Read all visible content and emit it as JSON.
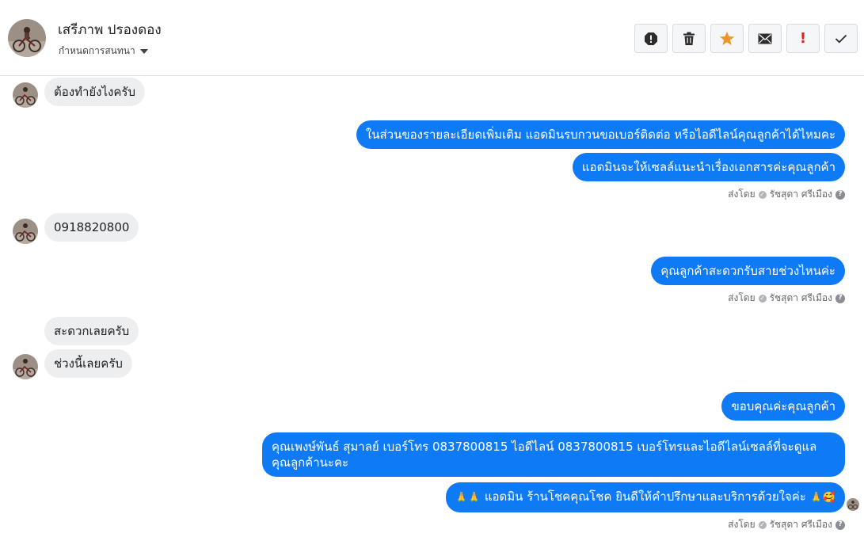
{
  "header": {
    "contact_name": "เสรีภาพ ปรองดอง",
    "assign_label": "กำหนดการสนทนา"
  },
  "toolbar": {
    "icons": [
      "info-icon",
      "trash-icon",
      "star-icon",
      "mail-icon",
      "important-icon",
      "check-icon"
    ],
    "star_color": "#f0952b",
    "important_color": "#e02020",
    "important_glyph": "!"
  },
  "messages": [
    {
      "dir": "in",
      "text": "ต้องทำยังไงครับ"
    },
    {
      "dir": "out",
      "text": "ในส่วนของรายละเอียดเพิ่มเติม แอดมินรบกวนขอเบอร์ติดต่อ หรือไอดีไลน์คุณลูกค้าได้ไหมคะ"
    },
    {
      "dir": "out",
      "text": "แอดมินจะให้เซลล์แนะนำเรื่องเอกสารค่ะคุณลูกค้า"
    },
    {
      "dir": "in",
      "text": "0918820800"
    },
    {
      "dir": "out",
      "text": "คุณลูกค้าสะดวกรับสายช่วงไหนค่ะ"
    },
    {
      "dir": "in",
      "text": "สะดวกเลยครับ"
    },
    {
      "dir": "in",
      "text": "ช่วงนี้เลยครับ"
    },
    {
      "dir": "out",
      "text": "ขอบคุณค่ะคุณลูกค้า"
    },
    {
      "dir": "out",
      "text": "คุณเพงษ์พันธ์ สุมาลย์      เบอร์โทร 0837800815  ไอดีไลน์ 0837800815   เบอร์โทรและไอดีไลน์เซลล์ที่จะดูแลคุณลูกค้านะคะ"
    },
    {
      "dir": "out",
      "text": "แอดมิน ร้านโชคคุณโชค ยินดีให้คำปรึกษาและบริการด้วยใจค่ะ",
      "prefix_emoji": "🙏🙏",
      "suffix_emoji": "🙏🥰"
    }
  ],
  "sent_by": {
    "prefix": "ส่งโดย",
    "agent": "รัชสุดา ศรีเมือง",
    "help_glyph": "?"
  },
  "colors": {
    "outgoing_bubble": "#0f7af5",
    "incoming_bubble": "#eceef0"
  }
}
